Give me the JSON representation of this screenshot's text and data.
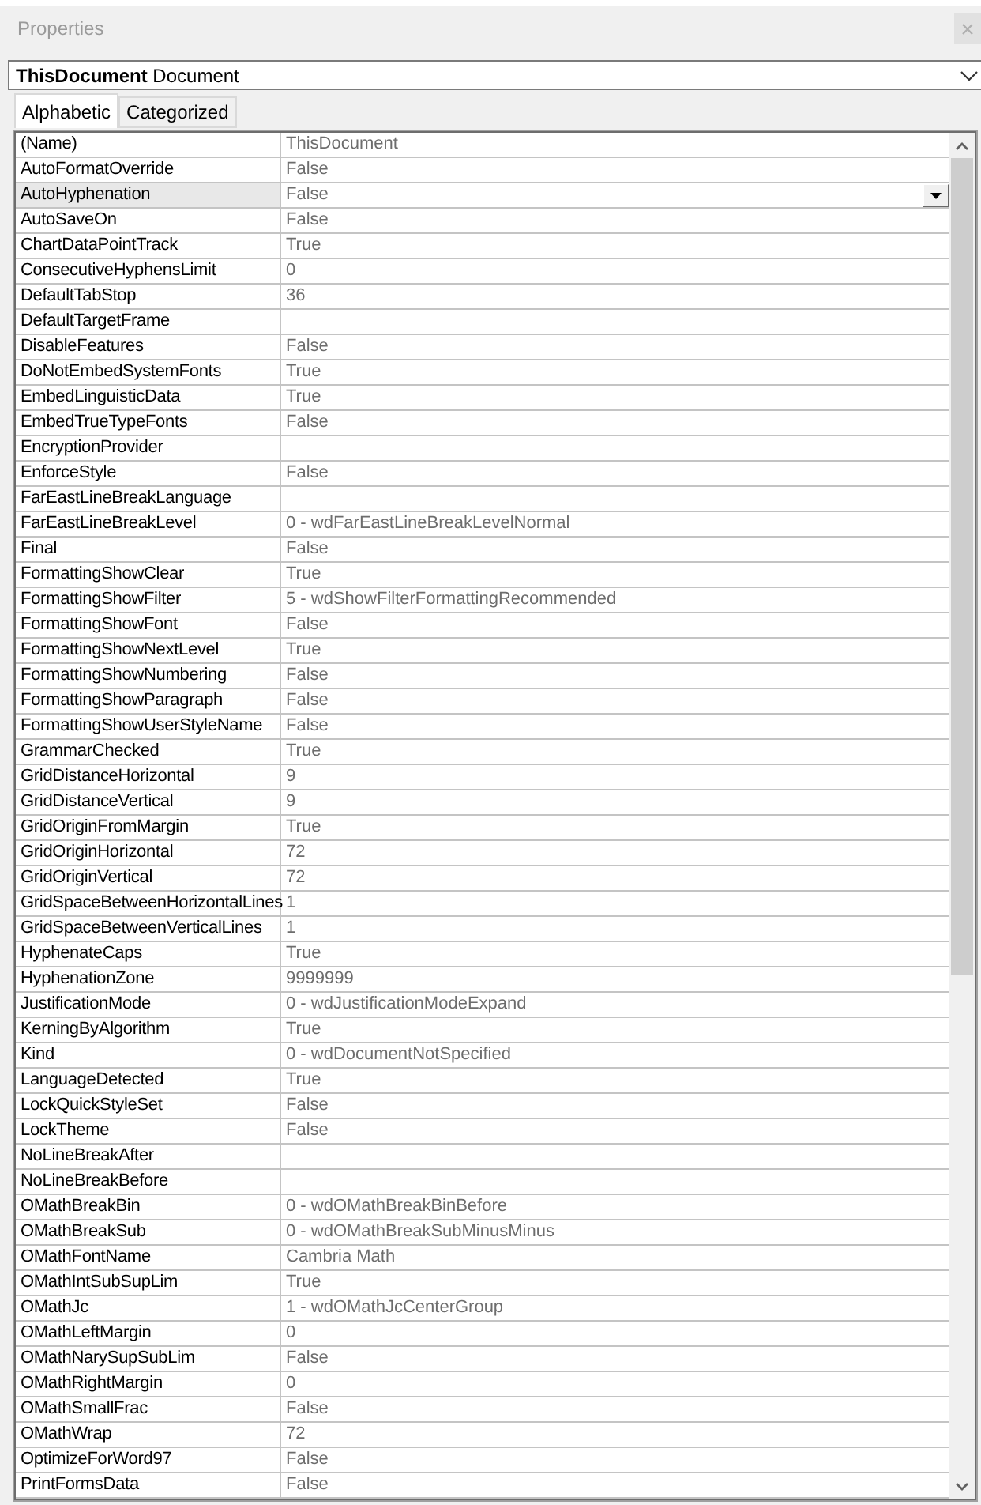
{
  "window": {
    "title": "Properties"
  },
  "object_selector": {
    "label": "**ThisDocument** Document"
  },
  "tabs": [
    {
      "label": "Alphabetic",
      "selected": true
    },
    {
      "label": "Categorized",
      "selected": false
    }
  ],
  "properties": [
    {
      "name": "(Name)",
      "value": "ThisDocument",
      "selected": false
    },
    {
      "name": "AutoFormatOverride",
      "value": "False",
      "selected": false
    },
    {
      "name": "AutoHyphenation",
      "value": "False",
      "selected": true
    },
    {
      "name": "AutoSaveOn",
      "value": "False",
      "selected": false
    },
    {
      "name": "ChartDataPointTrack",
      "value": "True",
      "selected": false
    },
    {
      "name": "ConsecutiveHyphensLimit",
      "value": "0",
      "selected": false
    },
    {
      "name": "DefaultTabStop",
      "value": "36",
      "selected": false
    },
    {
      "name": "DefaultTargetFrame",
      "selected": false
    },
    {
      "name": "DisableFeatures",
      "value": "False",
      "selected": false
    },
    {
      "name": "DoNotEmbedSystemFonts",
      "value": "True",
      "selected": false
    },
    {
      "name": "EmbedLinguisticData",
      "value": "True",
      "selected": false
    },
    {
      "name": "EmbedTrueTypeFonts",
      "value": "False",
      "selected": false
    },
    {
      "name": "EncryptionProvider",
      "selected": false
    },
    {
      "name": "EnforceStyle",
      "value": "False",
      "selected": false
    },
    {
      "name": "FarEastLineBreakLanguage",
      "selected": false
    },
    {
      "name": "FarEastLineBreakLevel",
      "value": "0 - wdFarEastLineBreakLevelNormal",
      "selected": false
    },
    {
      "name": "Final",
      "value": "False",
      "selected": false
    },
    {
      "name": "FormattingShowClear",
      "value": "True",
      "selected": false
    },
    {
      "name": "FormattingShowFilter",
      "value": "5 - wdShowFilterFormattingRecommended",
      "selected": false
    },
    {
      "name": "FormattingShowFont",
      "value": "False",
      "selected": false
    },
    {
      "name": "FormattingShowNextLevel",
      "value": "True",
      "selected": false
    },
    {
      "name": "FormattingShowNumbering",
      "value": "False",
      "selected": false
    },
    {
      "name": "FormattingShowParagraph",
      "value": "False",
      "selected": false
    },
    {
      "name": "FormattingShowUserStyleName",
      "value": "False",
      "selected": false
    },
    {
      "name": "GrammarChecked",
      "value": "True",
      "selected": false
    },
    {
      "name": "GridDistanceHorizontal",
      "value": "9",
      "selected": false
    },
    {
      "name": "GridDistanceVertical",
      "value": "9",
      "selected": false
    },
    {
      "name": "GridOriginFromMargin",
      "value": "True",
      "selected": false
    },
    {
      "name": "GridOriginHorizontal",
      "value": "72",
      "selected": false
    },
    {
      "name": "GridOriginVertical",
      "value": "72",
      "selected": false
    },
    {
      "name": "GridSpaceBetweenHorizontalLines",
      "value": "1",
      "selected": false
    },
    {
      "name": "GridSpaceBetweenVerticalLines",
      "value": "1",
      "selected": false
    },
    {
      "name": "HyphenateCaps",
      "value": "True",
      "selected": false
    },
    {
      "name": "HyphenationZone",
      "value": "9999999",
      "selected": false
    },
    {
      "name": "JustificationMode",
      "value": "0 - wdJustificationModeExpand",
      "selected": false
    },
    {
      "name": "KerningByAlgorithm",
      "value": "True",
      "selected": false
    },
    {
      "name": "Kind",
      "value": "0 - wdDocumentNotSpecified",
      "selected": false
    },
    {
      "name": "LanguageDetected",
      "value": "True",
      "selected": false
    },
    {
      "name": "LockQuickStyleSet",
      "value": "False",
      "selected": false
    },
    {
      "name": "LockTheme",
      "value": "False",
      "selected": false
    },
    {
      "name": "NoLineBreakAfter",
      "selected": false
    },
    {
      "name": "NoLineBreakBefore",
      "selected": false
    },
    {
      "name": "OMathBreakBin",
      "value": "0 - wdOMathBreakBinBefore",
      "selected": false
    },
    {
      "name": "OMathBreakSub",
      "value": "0 - wdOMathBreakSubMinusMinus",
      "selected": false
    },
    {
      "name": "OMathFontName",
      "value": "Cambria Math",
      "selected": false
    },
    {
      "name": "OMathIntSubSupLim",
      "value": "True",
      "selected": false
    },
    {
      "name": "OMathJc",
      "value": "1 - wdOMathJcCenterGroup",
      "selected": false
    },
    {
      "name": "OMathLeftMargin",
      "value": "0",
      "selected": false
    },
    {
      "name": "OMathNarySupSubLim",
      "value": "False",
      "selected": false
    },
    {
      "name": "OMathRightMargin",
      "value": "0",
      "selected": false
    },
    {
      "name": "OMathSmallFrac",
      "value": "False",
      "selected": false
    },
    {
      "name": "OMathWrap",
      "value": "72",
      "selected": false
    },
    {
      "name": "OptimizeForWord97",
      "value": "False",
      "selected": false
    },
    {
      "name": "PrintFormsData",
      "value": "False",
      "selected": false
    }
  ]
}
